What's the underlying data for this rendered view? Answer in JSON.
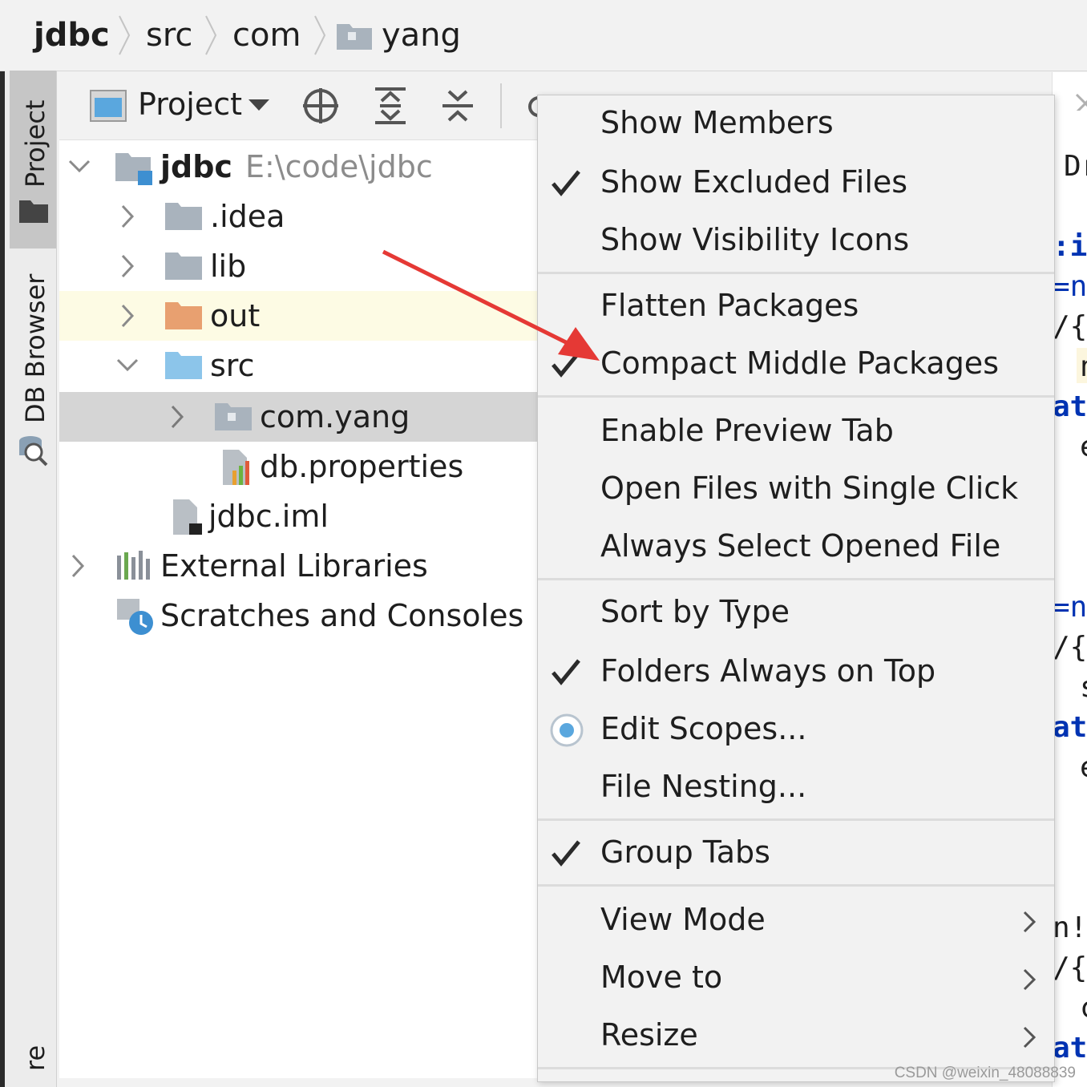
{
  "breadcrumb": {
    "items": [
      "jdbc",
      "src",
      "com",
      "yang"
    ]
  },
  "stripe": {
    "project_tab": "Project",
    "db_browser_tab": "DB Browser",
    "bottom_tab": "re"
  },
  "toolbar": {
    "view_selector": "Project"
  },
  "tree": {
    "root_name": "jdbc",
    "root_path": "E:\\code\\jdbc",
    "items": [
      {
        "label": ".idea"
      },
      {
        "label": "lib"
      },
      {
        "label": "out"
      },
      {
        "label": "src"
      },
      {
        "label": "com.yang"
      },
      {
        "label": "db.properties"
      },
      {
        "label": "jdbc.iml"
      },
      {
        "label": "External Libraries"
      },
      {
        "label": "Scratches and Consoles"
      }
    ]
  },
  "editor": {
    "tab_fragment": "Dr",
    "lines": [
      ":ic",
      "=nu",
      "/{",
      "n",
      "atc",
      "e",
      "=nu",
      "/{",
      "s",
      "atc",
      "e",
      "n!=",
      "/{",
      "c",
      "atc"
    ]
  },
  "menu": {
    "items": [
      {
        "label": "Show Members",
        "checked": false
      },
      {
        "label": "Show Excluded Files",
        "checked": true
      },
      {
        "label": "Show Visibility Icons",
        "checked": false
      },
      {
        "label": "Flatten Packages",
        "checked": false
      },
      {
        "label": "Compact Middle Packages",
        "checked": true
      },
      {
        "label": "Enable Preview Tab",
        "checked": false
      },
      {
        "label": "Open Files with Single Click",
        "checked": false
      },
      {
        "label": "Always Select Opened File",
        "checked": false
      },
      {
        "label": "Sort by Type",
        "checked": false
      },
      {
        "label": "Folders Always on Top",
        "checked": true
      },
      {
        "label": "Edit Scopes...",
        "checked": false,
        "icon": "scope-radio-icon"
      },
      {
        "label": "File Nesting...",
        "checked": false
      },
      {
        "label": "Group Tabs",
        "checked": true
      },
      {
        "label": "View Mode",
        "submenu": true
      },
      {
        "label": "Move to",
        "submenu": true
      },
      {
        "label": "Resize",
        "submenu": true
      }
    ]
  },
  "watermark": "CSDN @weixin_48088839",
  "colors": {
    "accent_blue": "#3d8fd1",
    "excluded_orange": "#e8a070",
    "annotation_red": "#e53935"
  }
}
